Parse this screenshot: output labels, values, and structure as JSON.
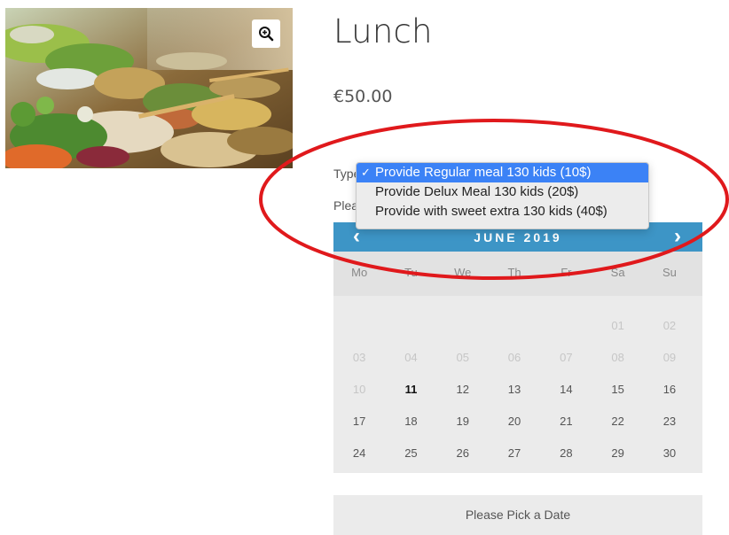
{
  "product": {
    "title": "Lunch",
    "price": "€50.00",
    "image_alt": "salad-buffet-image"
  },
  "form": {
    "type_label": "Type",
    "date_label": "Please",
    "options": [
      {
        "label": "Provide Regular meal 130 kids (10$)",
        "selected": true
      },
      {
        "label": "Provide Delux Meal 130 kids (20$)",
        "selected": false
      },
      {
        "label": "Provide with sweet extra 130 kids (40$)",
        "selected": false
      }
    ],
    "check_mark": "✓"
  },
  "calendar": {
    "month": "JUNE 2019",
    "prev": "‹",
    "next": "›",
    "weekdays": [
      "Mo",
      "Tu",
      "We",
      "Th",
      "Fr",
      "Sa",
      "Su"
    ],
    "weeks": [
      [
        "",
        "",
        "",
        "",
        "",
        "01",
        "02"
      ],
      [
        "03",
        "04",
        "05",
        "06",
        "07",
        "08",
        "09"
      ],
      [
        "10",
        "11",
        "12",
        "13",
        "14",
        "15",
        "16"
      ],
      [
        "17",
        "18",
        "19",
        "20",
        "21",
        "22",
        "23"
      ],
      [
        "24",
        "25",
        "26",
        "27",
        "28",
        "29",
        "30"
      ]
    ],
    "past_days": [
      "01",
      "02",
      "03",
      "04",
      "05",
      "06",
      "07",
      "08",
      "09",
      "10"
    ],
    "today": "11"
  },
  "pick_date_label": "Please Pick a Date",
  "colors": {
    "calendar_header": "#3d95c6",
    "selected_option": "#3b82f6",
    "annotation": "#e0191c"
  }
}
